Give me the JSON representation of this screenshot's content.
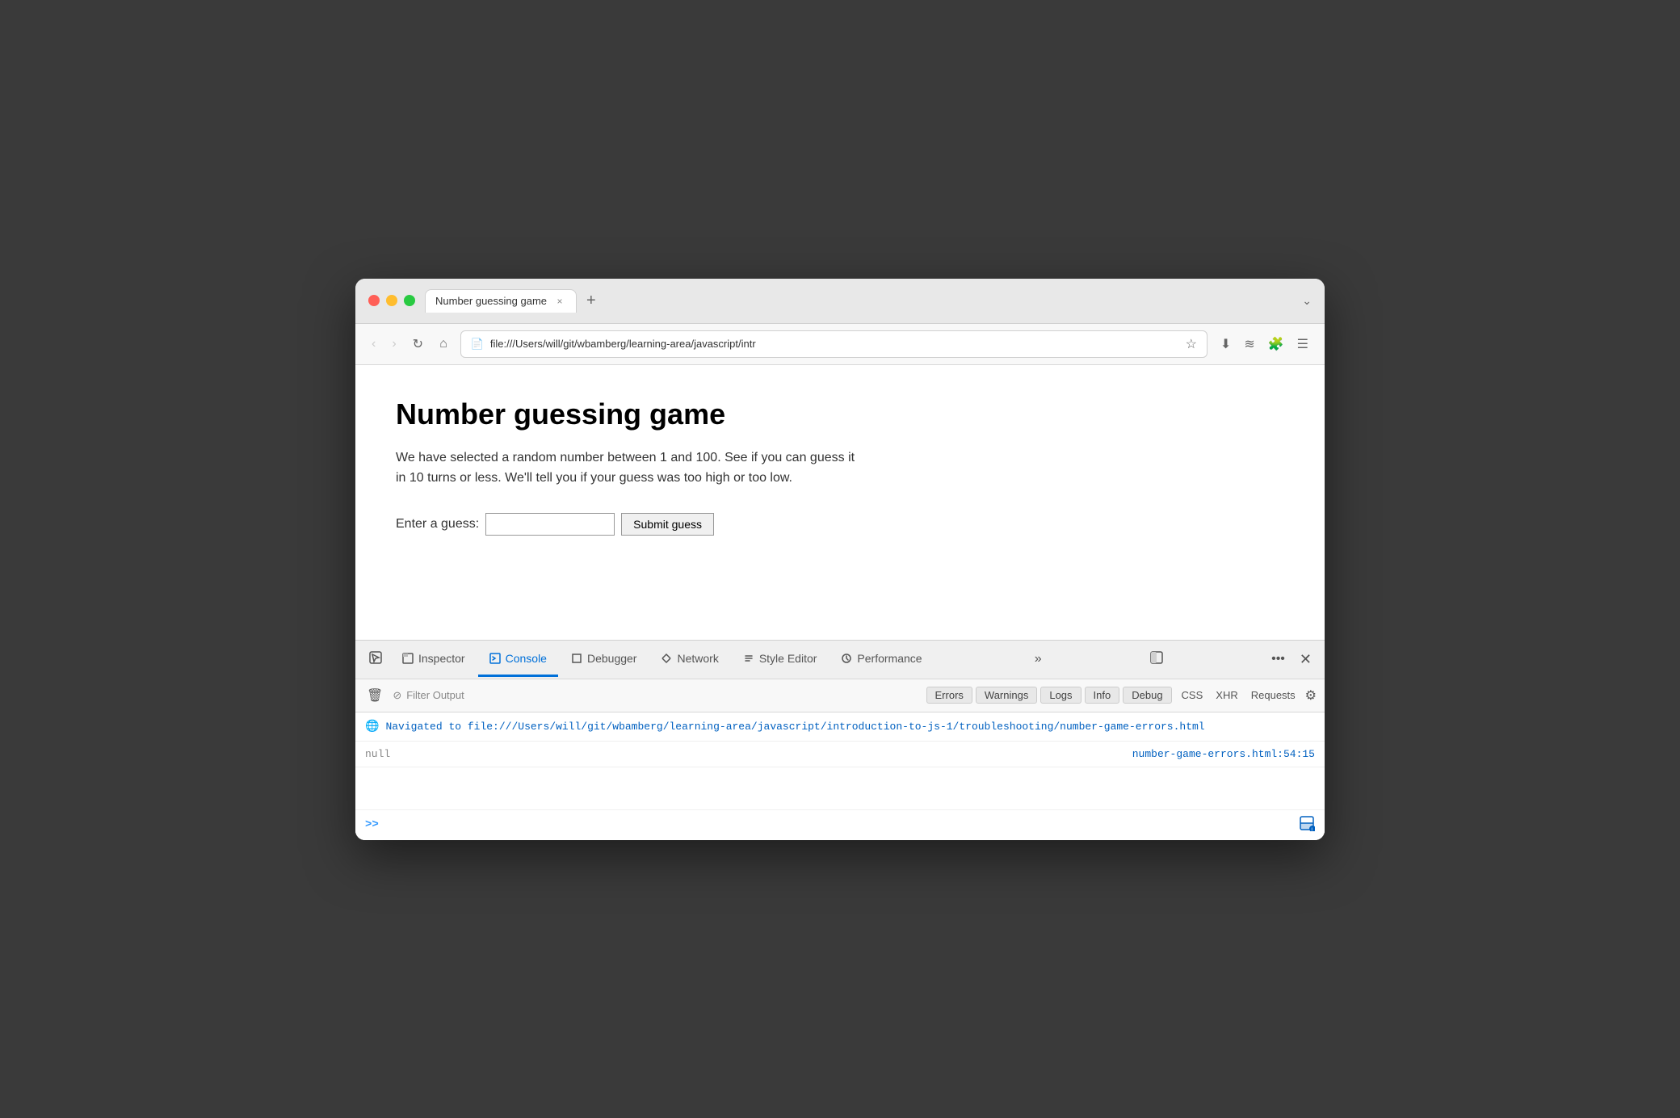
{
  "browser": {
    "traffic_lights": {
      "close": "close",
      "minimize": "minimize",
      "maximize": "maximize"
    },
    "tab": {
      "title": "Number guessing game",
      "close_label": "×"
    },
    "new_tab_label": "+",
    "tab_overflow_label": "⌄",
    "nav": {
      "back_label": "‹",
      "forward_label": "›",
      "reload_label": "↻",
      "home_label": "⌂",
      "address": "file:///Users/will/git/wbamberg/learning-area/javascript/intr",
      "star_label": "☆",
      "download_label": "⬇",
      "feed_label": "…",
      "extensions_label": "🧩",
      "menu_label": "☰"
    }
  },
  "page": {
    "title": "Number guessing game",
    "description": "We have selected a random number between 1 and 100. See if you can guess it in 10 turns or less. We'll tell you if your guess was too high or too low.",
    "form": {
      "label": "Enter a guess:",
      "input_placeholder": "",
      "submit_label": "Submit guess"
    }
  },
  "devtools": {
    "tabs": [
      {
        "id": "cursor",
        "label": "",
        "icon": "⬡",
        "active": false
      },
      {
        "id": "inspector",
        "label": "Inspector",
        "icon": "⬜",
        "active": false
      },
      {
        "id": "console",
        "label": "Console",
        "icon": "▶",
        "active": true
      },
      {
        "id": "debugger",
        "label": "Debugger",
        "icon": "⬡",
        "active": false
      },
      {
        "id": "network",
        "label": "Network",
        "icon": "↑↓",
        "active": false
      },
      {
        "id": "style-editor",
        "label": "Style Editor",
        "icon": "{}",
        "active": false
      },
      {
        "id": "performance",
        "label": "Performance",
        "icon": "◎",
        "active": false
      }
    ],
    "overflow_label": "»",
    "dock_label": "⬜",
    "more_label": "•••",
    "close_label": "✕",
    "console": {
      "toolbar": {
        "trash_label": "🗑",
        "filter_placeholder": "Filter Output",
        "filter_icon": "⊘",
        "badges": [
          {
            "id": "errors",
            "label": "Errors"
          },
          {
            "id": "warnings",
            "label": "Warnings"
          },
          {
            "id": "logs",
            "label": "Logs"
          },
          {
            "id": "info",
            "label": "Info"
          },
          {
            "id": "debug",
            "label": "Debug"
          }
        ],
        "right_filters": [
          {
            "id": "css",
            "label": "CSS"
          },
          {
            "id": "xhr",
            "label": "XHR"
          },
          {
            "id": "requests",
            "label": "Requests"
          }
        ],
        "settings_label": "⚙"
      },
      "messages": [
        {
          "id": "nav-message",
          "type": "navigation",
          "icon": "🌐",
          "text": "Navigated to file:///Users/will/git/wbamberg/learning-area/javascript/introduction-to-js-1/troubleshooting/number-game-errors.html",
          "source": null
        },
        {
          "id": "null-message",
          "type": "null-value",
          "icon": null,
          "text": "null",
          "source": "number-game-errors.html:54:15"
        }
      ],
      "input": {
        "chevron": "»",
        "split_icon": "⬜"
      }
    }
  }
}
